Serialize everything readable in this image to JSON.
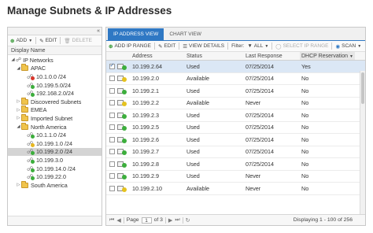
{
  "page": {
    "title": "Manage Subnets & IP Addresses"
  },
  "left_toolbar": {
    "add": "ADD",
    "edit": "EDIT",
    "delete": "DELETE"
  },
  "tree": {
    "header": "Display Name",
    "items": [
      {
        "label": "IP Networks",
        "type": "root",
        "expanded": true
      },
      {
        "label": "APAC",
        "type": "folder",
        "expanded": true
      },
      {
        "label": "10.1.0.0 /24",
        "type": "subnet",
        "status": "red"
      },
      {
        "label": "10.199.5.0/24",
        "type": "subnet",
        "status": "green"
      },
      {
        "label": "192.168.2.0/24",
        "type": "subnet",
        "status": "green"
      },
      {
        "label": "Discovered Subnets",
        "type": "folder",
        "expanded": false
      },
      {
        "label": "EMEA",
        "type": "folder",
        "expanded": false
      },
      {
        "label": "Imported Subnet",
        "type": "folder",
        "expanded": false
      },
      {
        "label": "North America",
        "type": "folder",
        "expanded": true
      },
      {
        "label": "10.1.1.0 /24",
        "type": "subnet",
        "status": "green"
      },
      {
        "label": "10.199.1.0 /24",
        "type": "subnet",
        "status": "warning"
      },
      {
        "label": "10.199.2.0 /24",
        "type": "subnet",
        "status": "green",
        "selected": true
      },
      {
        "label": "10.199.3.0",
        "type": "subnet",
        "status": "green"
      },
      {
        "label": "10.199.14.0 /24",
        "type": "subnet",
        "status": "green"
      },
      {
        "label": "10.199.22.0",
        "type": "subnet",
        "status": "green"
      },
      {
        "label": "South America",
        "type": "folder",
        "expanded": false
      }
    ]
  },
  "tabs": {
    "ip_address_view": "IP ADDRESS VIEW",
    "chart_view": "CHART VIEW"
  },
  "right_toolbar": {
    "add_ip_range": "ADD IP RANGE",
    "edit": "EDIT",
    "view_details": "VIEW DETAILS",
    "filter_label": "Filter:",
    "filter_value": "ALL",
    "select_ip_range": "SELECT IP RANGE",
    "scan": "SCAN"
  },
  "grid": {
    "columns": {
      "address": "Address",
      "status": "Status",
      "last_response": "Last Response",
      "dhcp": "DHCP Reservation"
    },
    "rows": [
      {
        "address": "10.199.2.64",
        "status": "Used",
        "last_response": "07/25/2014",
        "dhcp": "Yes",
        "indicator": "green",
        "checked": true
      },
      {
        "address": "10.199.2.0",
        "status": "Available",
        "last_response": "07/25/2014",
        "dhcp": "No",
        "indicator": "yellow",
        "checked": false
      },
      {
        "address": "10.199.2.1",
        "status": "Used",
        "last_response": "07/25/2014",
        "dhcp": "No",
        "indicator": "green",
        "checked": false
      },
      {
        "address": "10.199.2.2",
        "status": "Available",
        "last_response": "Never",
        "dhcp": "No",
        "indicator": "yellow",
        "checked": false
      },
      {
        "address": "10.199.2.3",
        "status": "Used",
        "last_response": "07/25/2014",
        "dhcp": "No",
        "indicator": "green",
        "checked": false
      },
      {
        "address": "10.199.2.5",
        "status": "Used",
        "last_response": "07/25/2014",
        "dhcp": "No",
        "indicator": "green",
        "checked": false
      },
      {
        "address": "10.199.2.6",
        "status": "Used",
        "last_response": "07/25/2014",
        "dhcp": "No",
        "indicator": "green",
        "checked": false
      },
      {
        "address": "10.199.2.7",
        "status": "Used",
        "last_response": "07/25/2014",
        "dhcp": "No",
        "indicator": "green",
        "checked": false
      },
      {
        "address": "10.199.2.8",
        "status": "Used",
        "last_response": "07/25/2014",
        "dhcp": "No",
        "indicator": "green",
        "checked": false
      },
      {
        "address": "10.199.2.9",
        "status": "Used",
        "last_response": "Never",
        "dhcp": "No",
        "indicator": "green",
        "checked": false
      },
      {
        "address": "10.199.2.10",
        "status": "Available",
        "last_response": "Never",
        "dhcp": "No",
        "indicator": "yellow",
        "checked": false
      }
    ]
  },
  "pager": {
    "page_label": "Page",
    "current_page": "1",
    "of_label": "of 3",
    "summary": "Displaying 1 - 100 of 256"
  },
  "colors": {
    "accent": "#2f78c4",
    "status_green": "#3cae3c",
    "status_yellow": "#e5c21e",
    "status_red": "#d9362b"
  }
}
